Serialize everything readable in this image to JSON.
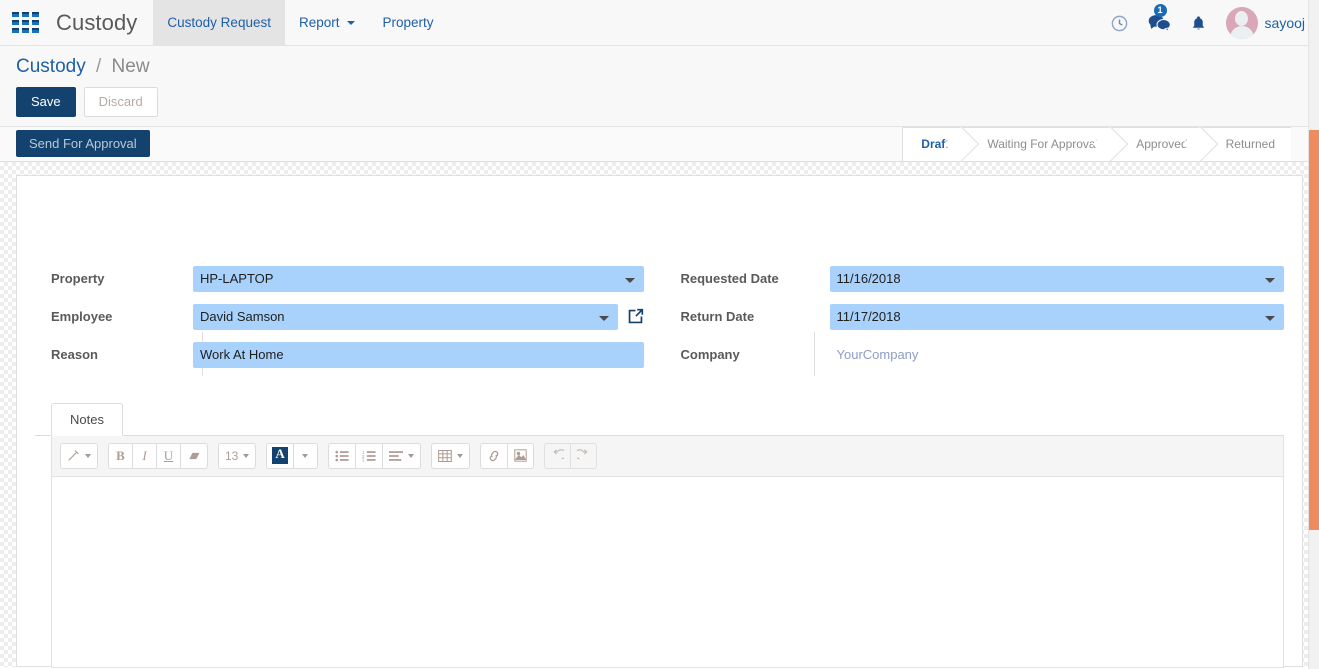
{
  "navbar": {
    "apps_icon": "apps-grid-icon",
    "brand": "Custody",
    "menu": [
      {
        "label": "Custody Request",
        "active": true,
        "has_caret": false
      },
      {
        "label": "Report",
        "active": false,
        "has_caret": true
      },
      {
        "label": "Property",
        "active": false,
        "has_caret": false
      }
    ],
    "icons": [
      {
        "name": "clock-icon"
      },
      {
        "name": "messages-icon",
        "badge": "1"
      },
      {
        "name": "bell-icon"
      }
    ],
    "user": {
      "name": "sayooj",
      "avatar": "user-avatar"
    }
  },
  "control_panel": {
    "breadcrumb": {
      "root": "Custody",
      "separator": "/",
      "current": "New"
    },
    "save_label": "Save",
    "discard_label": "Discard"
  },
  "status_row": {
    "workflow_button": "Send For Approval",
    "statuses": [
      {
        "label": "Draft",
        "active": true
      },
      {
        "label": "Waiting For Approval",
        "active": false
      },
      {
        "label": "Approved",
        "active": false
      },
      {
        "label": "Returned",
        "active": false
      }
    ]
  },
  "form": {
    "left": [
      {
        "label": "Property",
        "value": "HP-LAPTOP",
        "type": "select"
      },
      {
        "label": "Employee",
        "value": "David Samson",
        "type": "select",
        "external_link": true
      },
      {
        "label": "Reason",
        "value": "Work At Home",
        "type": "text"
      }
    ],
    "right": [
      {
        "label": "Requested Date",
        "value": "11/16/2018",
        "type": "select"
      },
      {
        "label": "Return Date",
        "value": "11/17/2018",
        "type": "select"
      },
      {
        "label": "Company",
        "value": "YourCompany",
        "type": "readonly"
      }
    ]
  },
  "notebook": {
    "tabs": [
      {
        "label": "Notes",
        "active": true
      }
    ],
    "editor": {
      "content": "",
      "toolbar": {
        "font_size": "13",
        "buttons": [
          {
            "name": "style-wand-icon",
            "glyph": "✐",
            "caret": true
          },
          {
            "name": "bold-button",
            "glyph": "B"
          },
          {
            "name": "italic-button",
            "glyph": "I"
          },
          {
            "name": "underline-button",
            "glyph": "U"
          },
          {
            "name": "clear-format-button",
            "glyph": "▱"
          },
          {
            "name": "font-size-dropdown",
            "glyph": "13",
            "caret": true
          },
          {
            "name": "font-color-button",
            "glyph": "A"
          },
          {
            "name": "font-color-dropdown",
            "glyph": "",
            "caret": true
          },
          {
            "name": "unordered-list-button",
            "glyph": "≡"
          },
          {
            "name": "ordered-list-button",
            "glyph": "≡"
          },
          {
            "name": "align-dropdown",
            "glyph": "≡",
            "caret": true
          },
          {
            "name": "table-dropdown",
            "glyph": "▦",
            "caret": true
          },
          {
            "name": "link-button",
            "glyph": "🔗"
          },
          {
            "name": "image-button",
            "glyph": "🖾"
          },
          {
            "name": "undo-button",
            "glyph": "↺"
          },
          {
            "name": "redo-button",
            "glyph": "↻"
          }
        ]
      }
    }
  },
  "scrollbar": {
    "name": "vertical-scrollbar",
    "thumb_color": "#ee8c60"
  },
  "colors": {
    "primary": "#14426f",
    "link": "#1f5fa9",
    "field_highlight": "#a8d2fb",
    "scroll_thumb": "#ee8c60"
  }
}
